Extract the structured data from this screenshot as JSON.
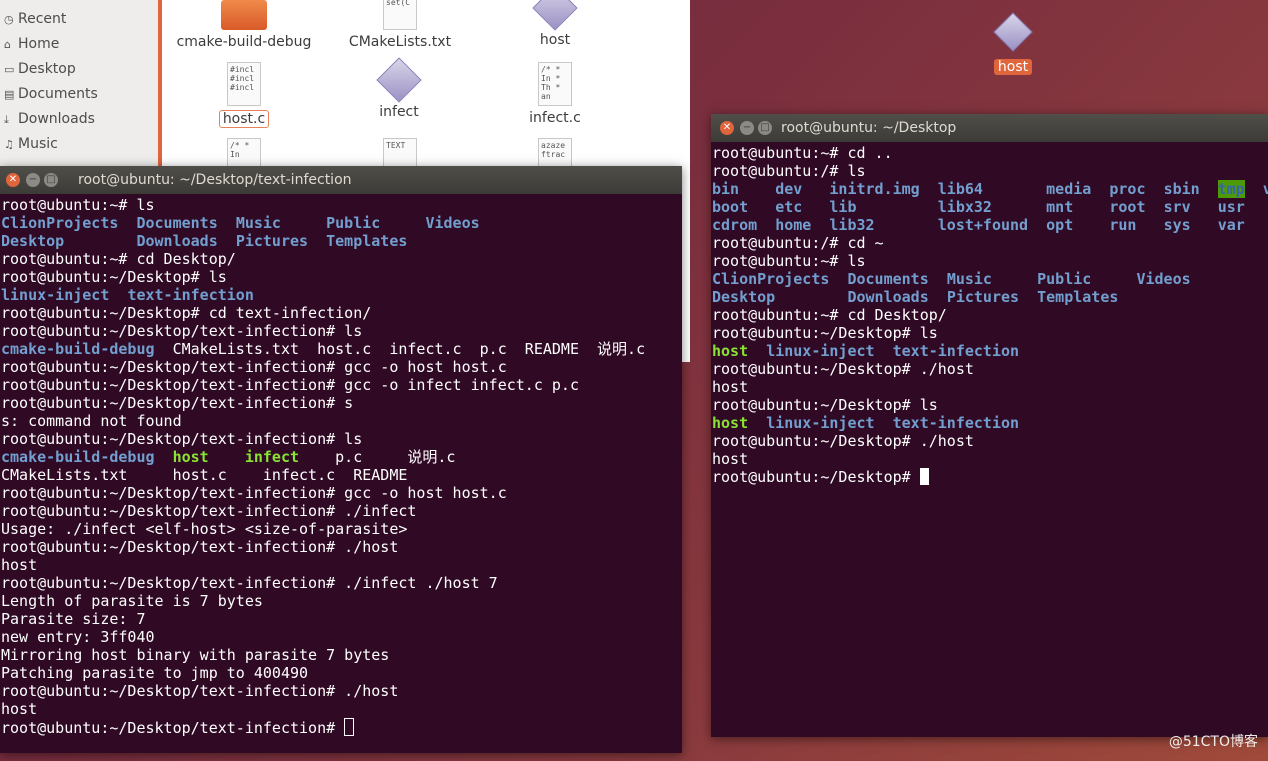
{
  "file_manager": {
    "sidebar": [
      {
        "label": "Recent",
        "icon": "clock-icon"
      },
      {
        "label": "Home",
        "icon": "home-icon"
      },
      {
        "label": "Desktop",
        "icon": "desktop-icon"
      },
      {
        "label": "Documents",
        "icon": "document-icon"
      },
      {
        "label": "Downloads",
        "icon": "download-icon"
      },
      {
        "label": "Music",
        "icon": "music-icon"
      }
    ],
    "items": [
      {
        "label": "cmake-build-debug",
        "type": "folder"
      },
      {
        "label": "CMakeLists.txt",
        "type": "text",
        "preview": "proje\n\nset(C"
      },
      {
        "label": "host",
        "type": "executable"
      },
      {
        "label": "host.c",
        "type": "text",
        "preview": "#incl\n#incl\n#incl",
        "selected": true
      },
      {
        "label": "infect",
        "type": "executable"
      },
      {
        "label": "infect.c",
        "type": "text",
        "preview": "/*\n * In\n * Th\n * an"
      },
      {
        "label": "",
        "type": "text",
        "preview": "/*\n * In"
      },
      {
        "label": "",
        "type": "text",
        "preview": "TEXT"
      },
      {
        "label": "",
        "type": "text",
        "preview": "azaze\nftrac"
      }
    ]
  },
  "desktop_icon": {
    "label": "host"
  },
  "terminal_left": {
    "title": "root@ubuntu: ~/Desktop/text-infection",
    "lines": [
      [
        {
          "t": "root@ubuntu:~# ls"
        }
      ],
      [
        {
          "t": "ClionProjects",
          "c": "blue"
        },
        {
          "t": "  "
        },
        {
          "t": "Documents",
          "c": "blue"
        },
        {
          "t": "  "
        },
        {
          "t": "Music",
          "c": "blue"
        },
        {
          "t": "     "
        },
        {
          "t": "Public",
          "c": "blue"
        },
        {
          "t": "     "
        },
        {
          "t": "Videos",
          "c": "blue"
        }
      ],
      [
        {
          "t": "Desktop",
          "c": "blue"
        },
        {
          "t": "        "
        },
        {
          "t": "Downloads",
          "c": "blue"
        },
        {
          "t": "  "
        },
        {
          "t": "Pictures",
          "c": "blue"
        },
        {
          "t": "  "
        },
        {
          "t": "Templates",
          "c": "blue"
        }
      ],
      [
        {
          "t": "root@ubuntu:~# cd Desktop/"
        }
      ],
      [
        {
          "t": "root@ubuntu:~/Desktop# ls"
        }
      ],
      [
        {
          "t": "linux-inject",
          "c": "blue"
        },
        {
          "t": "  "
        },
        {
          "t": "text-infection",
          "c": "blue"
        }
      ],
      [
        {
          "t": "root@ubuntu:~/Desktop# cd text-infection/"
        }
      ],
      [
        {
          "t": "root@ubuntu:~/Desktop/text-infection# ls"
        }
      ],
      [
        {
          "t": "cmake-build-debug",
          "c": "blue"
        },
        {
          "t": "  CMakeLists.txt  host.c  infect.c  p.c  README  说明.c"
        }
      ],
      [
        {
          "t": "root@ubuntu:~/Desktop/text-infection# gcc -o host host.c"
        }
      ],
      [
        {
          "t": "root@ubuntu:~/Desktop/text-infection# gcc -o infect infect.c p.c"
        }
      ],
      [
        {
          "t": "root@ubuntu:~/Desktop/text-infection# s"
        }
      ],
      [
        {
          "t": "s: command not found"
        }
      ],
      [
        {
          "t": "root@ubuntu:~/Desktop/text-infection# ls"
        }
      ],
      [
        {
          "t": "cmake-build-debug",
          "c": "blue"
        },
        {
          "t": "  "
        },
        {
          "t": "host",
          "c": "green"
        },
        {
          "t": "    "
        },
        {
          "t": "infect",
          "c": "green"
        },
        {
          "t": "    p.c     说明.c"
        }
      ],
      [
        {
          "t": "CMakeLists.txt     host.c    infect.c  README"
        }
      ],
      [
        {
          "t": "root@ubuntu:~/Desktop/text-infection# gcc -o host host.c"
        }
      ],
      [
        {
          "t": "root@ubuntu:~/Desktop/text-infection# ./infect"
        }
      ],
      [
        {
          "t": "Usage: ./infect <elf-host> <size-of-parasite>"
        }
      ],
      [
        {
          "t": "root@ubuntu:~/Desktop/text-infection# ./host"
        }
      ],
      [
        {
          "t": "host"
        }
      ],
      [
        {
          "t": "root@ubuntu:~/Desktop/text-infection# ./infect ./host 7"
        }
      ],
      [
        {
          "t": "Length of parasite is 7 bytes"
        }
      ],
      [
        {
          "t": "Parasite size: 7"
        }
      ],
      [
        {
          "t": "new entry: 3ff040"
        }
      ],
      [
        {
          "t": "Mirroring host binary with parasite 7 bytes"
        }
      ],
      [
        {
          "t": "Patching parasite to jmp to 400490"
        }
      ],
      [
        {
          "t": "root@ubuntu:~/Desktop/text-infection# ./host"
        }
      ],
      [
        {
          "t": "host"
        }
      ],
      [
        {
          "t": "root@ubuntu:~/Desktop/text-infection# "
        },
        {
          "cursor": "hollow"
        }
      ]
    ]
  },
  "terminal_right": {
    "title": "root@ubuntu: ~/Desktop",
    "lines": [
      [
        {
          "t": "root@ubuntu:~# cd .."
        }
      ],
      [
        {
          "t": "root@ubuntu:/# ls"
        }
      ],
      [
        {
          "t": "bin",
          "c": "blue"
        },
        {
          "t": "    "
        },
        {
          "t": "dev",
          "c": "blue"
        },
        {
          "t": "   "
        },
        {
          "t": "initrd.img",
          "c": "blue"
        },
        {
          "t": "  "
        },
        {
          "t": "lib64",
          "c": "blue"
        },
        {
          "t": "       "
        },
        {
          "t": "media",
          "c": "blue"
        },
        {
          "t": "  "
        },
        {
          "t": "proc",
          "c": "blue"
        },
        {
          "t": "  "
        },
        {
          "t": "sbin",
          "c": "blue"
        },
        {
          "t": "  "
        },
        {
          "t": "tmp",
          "c": "tmp"
        },
        {
          "t": "  "
        },
        {
          "t": "vmlinuz",
          "c": "blue"
        }
      ],
      [
        {
          "t": "boot",
          "c": "blue"
        },
        {
          "t": "   "
        },
        {
          "t": "etc",
          "c": "blue"
        },
        {
          "t": "   "
        },
        {
          "t": "lib",
          "c": "blue"
        },
        {
          "t": "         "
        },
        {
          "t": "libx32",
          "c": "blue"
        },
        {
          "t": "      "
        },
        {
          "t": "mnt",
          "c": "blue"
        },
        {
          "t": "    "
        },
        {
          "t": "root",
          "c": "blue"
        },
        {
          "t": "  "
        },
        {
          "t": "srv",
          "c": "blue"
        },
        {
          "t": "   "
        },
        {
          "t": "usr",
          "c": "blue"
        }
      ],
      [
        {
          "t": "cdrom",
          "c": "blue"
        },
        {
          "t": "  "
        },
        {
          "t": "home",
          "c": "blue"
        },
        {
          "t": "  "
        },
        {
          "t": "lib32",
          "c": "blue"
        },
        {
          "t": "       "
        },
        {
          "t": "lost+found",
          "c": "blue"
        },
        {
          "t": "  "
        },
        {
          "t": "opt",
          "c": "blue"
        },
        {
          "t": "    "
        },
        {
          "t": "run",
          "c": "blue"
        },
        {
          "t": "   "
        },
        {
          "t": "sys",
          "c": "blue"
        },
        {
          "t": "   "
        },
        {
          "t": "var",
          "c": "blue"
        }
      ],
      [
        {
          "t": "root@ubuntu:/# cd ~"
        }
      ],
      [
        {
          "t": "root@ubuntu:~# ls"
        }
      ],
      [
        {
          "t": "ClionProjects",
          "c": "blue"
        },
        {
          "t": "  "
        },
        {
          "t": "Documents",
          "c": "blue"
        },
        {
          "t": "  "
        },
        {
          "t": "Music",
          "c": "blue"
        },
        {
          "t": "     "
        },
        {
          "t": "Public",
          "c": "blue"
        },
        {
          "t": "     "
        },
        {
          "t": "Videos",
          "c": "blue"
        }
      ],
      [
        {
          "t": "Desktop",
          "c": "blue"
        },
        {
          "t": "        "
        },
        {
          "t": "Downloads",
          "c": "blue"
        },
        {
          "t": "  "
        },
        {
          "t": "Pictures",
          "c": "blue"
        },
        {
          "t": "  "
        },
        {
          "t": "Templates",
          "c": "blue"
        }
      ],
      [
        {
          "t": "root@ubuntu:~# cd Desktop/"
        }
      ],
      [
        {
          "t": "root@ubuntu:~/Desktop# ls"
        }
      ],
      [
        {
          "t": "host",
          "c": "green"
        },
        {
          "t": "  "
        },
        {
          "t": "linux-inject",
          "c": "blue"
        },
        {
          "t": "  "
        },
        {
          "t": "text-infection",
          "c": "blue"
        }
      ],
      [
        {
          "t": "root@ubuntu:~/Desktop# ./host"
        }
      ],
      [
        {
          "t": "host"
        }
      ],
      [
        {
          "t": "root@ubuntu:~/Desktop# ls"
        }
      ],
      [
        {
          "t": "host",
          "c": "green"
        },
        {
          "t": "  "
        },
        {
          "t": "linux-inject",
          "c": "blue"
        },
        {
          "t": "  "
        },
        {
          "t": "text-infection",
          "c": "blue"
        }
      ],
      [
        {
          "t": "root@ubuntu:~/Desktop# ./host"
        }
      ],
      [
        {
          "t": "host"
        }
      ],
      [
        {
          "t": "root@ubuntu:~/Desktop# "
        },
        {
          "cursor": "solid"
        }
      ]
    ]
  },
  "watermark": "@51CTO博客",
  "colors": {
    "terminal_bg": "#300a24",
    "dir_blue": "#729fcf",
    "exec_green": "#8ae234",
    "accent_orange": "#e0643c"
  }
}
